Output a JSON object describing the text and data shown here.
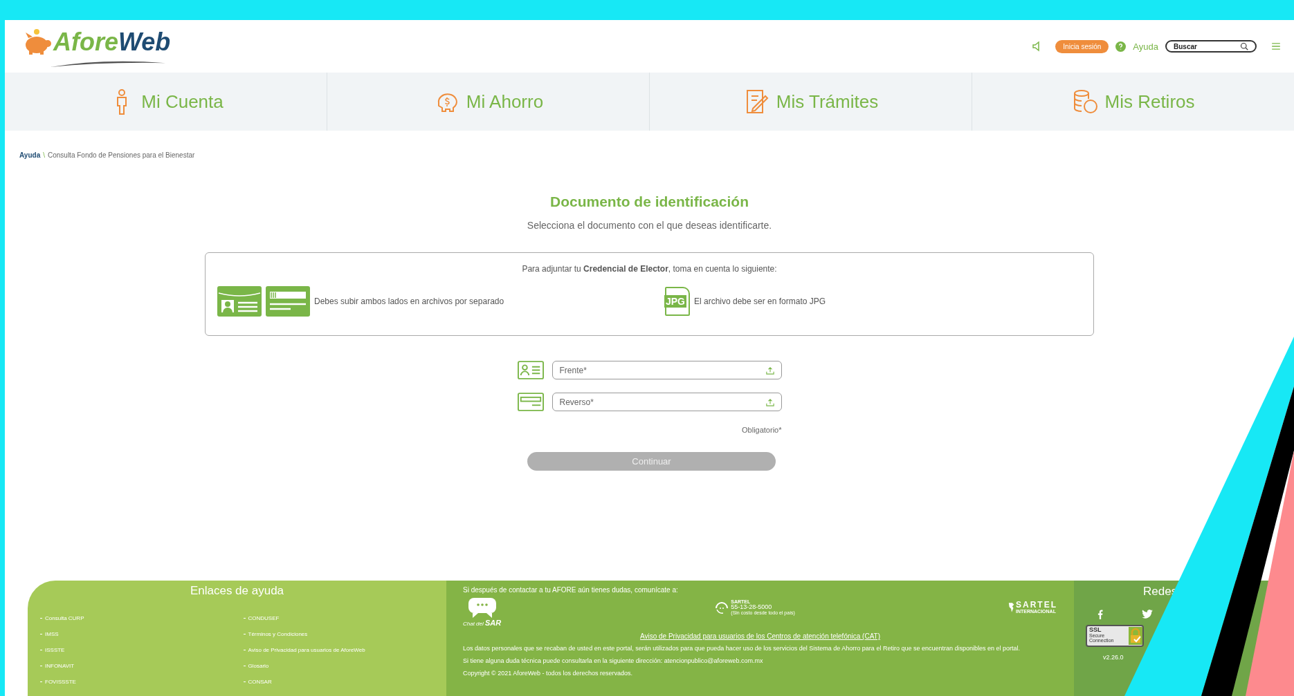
{
  "header": {
    "logo": {
      "first": "Afore",
      "second": "Web"
    },
    "login_button": "Inicia sesión",
    "help_link": "Ayuda",
    "search": {
      "placeholder": "Buscar"
    }
  },
  "nav": [
    {
      "label": "Mi Cuenta",
      "kind": "account"
    },
    {
      "label": "Mi Ahorro",
      "kind": "savings"
    },
    {
      "label": "Mis Trámites",
      "kind": "procedures"
    },
    {
      "label": "Mis Retiros",
      "kind": "withdrawals"
    }
  ],
  "breadcrumb": {
    "items": [
      "Ayuda",
      "Consulta Fondo de Pensiones para el Bienestar"
    ],
    "separator": "\\"
  },
  "page": {
    "title": "Documento de identificación",
    "subtitle": "Selecciona el documento con el que deseas identificarte."
  },
  "notice": {
    "intro": "Para adjuntar tu **Credencial de Elector**, toma en cuenta lo siguiente:",
    "items": [
      {
        "kind": "id-cards",
        "text": "Debes subir ambos lados en archivos por separado"
      },
      {
        "kind": "file",
        "icon_text": "JPG",
        "text": "El archivo debe ser en formato JPG"
      }
    ]
  },
  "upload_fields": [
    {
      "kind": "front",
      "placeholder": "Frente*"
    },
    {
      "kind": "back",
      "placeholder": "Reverso*"
    }
  ],
  "required_note": "Obligatorio*",
  "continue_button": {
    "label": "Continuar",
    "disabled": true
  },
  "footer": {
    "help_links": {
      "title": "Enlaces de ayuda",
      "columns": [
        [
          "Consulta CURP",
          "IMSS",
          "ISSSTE",
          "INFONAVIT",
          "FOVISSSTE"
        ],
        [
          "CONDUSEF",
          "Términos y Condiciones",
          "Aviso de Privacidad para usuarios de AforeWeb",
          "Glosario",
          "CONSAR"
        ]
      ]
    },
    "contact": {
      "intro": "Si después de contactar a tu AFORE aún tienes dudas, comunícate a:",
      "chat_logo": {
        "small": "Chat del",
        "big": "SAR"
      },
      "sartel": {
        "name": "SARTEL",
        "phone": "55-13-28-5000",
        "note": "(Sin costo desde todo el país)"
      },
      "international": {
        "name": "SARTEL",
        "sub": "INTERNACIONAL"
      },
      "privacy_link": "Aviso de Privacidad para usuarios de los Centros de atención telefónica (CAT)",
      "paragraphs": [
        "Los datos personales que se recaban de usted en este portal, serán utilizados para que pueda hacer uso de los servicios del Sistema de Ahorro para el Retiro que se encuentran disponibles en el portal.",
        "Si tiene alguna duda técnica puede consultarla en la siguiente dirección: atencionpublico@aforeweb.com.mx",
        "Copyright © 2021 AforeWeb - todos los derechos reservados."
      ]
    },
    "social": {
      "title": "Redes",
      "ssl_badge": [
        "SSL",
        "Secure",
        "Connection"
      ],
      "version": "v2.26.0"
    }
  }
}
